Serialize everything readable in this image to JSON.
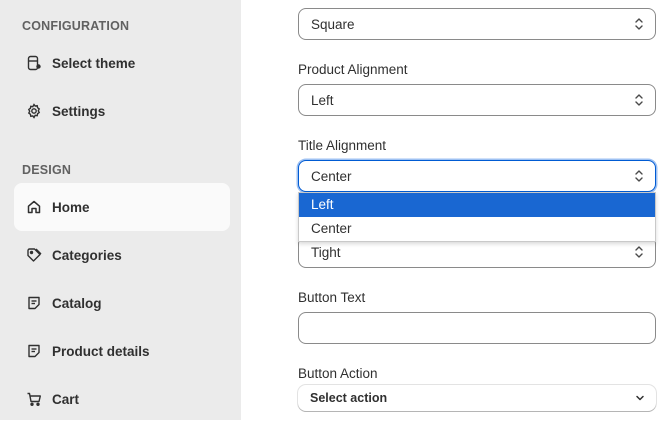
{
  "sidebar": {
    "configuration_heading": "CONFIGURATION",
    "design_heading": "DESIGN",
    "config_items": [
      {
        "label": "Select theme",
        "icon": "theme-icon"
      },
      {
        "label": "Settings",
        "icon": "gear-icon"
      }
    ],
    "design_items": [
      {
        "label": "Home",
        "icon": "home-icon",
        "active": true
      },
      {
        "label": "Categories",
        "icon": "tag-icon"
      },
      {
        "label": "Catalog",
        "icon": "page-icon"
      },
      {
        "label": "Product details",
        "icon": "page-icon"
      },
      {
        "label": "Cart",
        "icon": "cart-icon"
      }
    ]
  },
  "form": {
    "image_shape": {
      "value": "Square"
    },
    "product_alignment": {
      "label": "Product Alignment",
      "value": "Left"
    },
    "title_alignment": {
      "label": "Title Alignment",
      "value": "Center",
      "options": [
        "Left",
        "Center"
      ],
      "highlighted_option": "Left"
    },
    "spacing": {
      "value": "Tight"
    },
    "button_text": {
      "label": "Button Text",
      "value": ""
    },
    "button_action": {
      "label": "Button Action",
      "value": "Select action"
    }
  },
  "colors": {
    "accent": "#005bd3",
    "highlight": "#1967d2",
    "sidebar_bg": "#ebebeb"
  }
}
